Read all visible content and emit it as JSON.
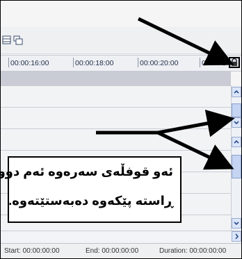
{
  "ruler": {
    "ticks": [
      "00:00:16:00",
      "00:00:18:00",
      "00:00:20:00",
      "00:00:2"
    ]
  },
  "status": {
    "start": "Start: 00:00:00:00",
    "end": "End: 00:00:00:00",
    "duration": "Duration: 00:00:00:00"
  },
  "caption": {
    "line1": "ئەو قوفڵەی سەرەوە ئەم دوو",
    "line2": "ڕاستە پێکەوە دەبەستێتەوە."
  },
  "icons": {
    "lock": "lock-icon",
    "scroll_up": "chevron-up-icon",
    "scroll_down": "chevron-down-icon",
    "scroll_right": "chevron-right-icon"
  },
  "colors": {
    "arrow": "#000000",
    "ruler_bg": "#eef0f4",
    "scroll_button": "#dbe6fa",
    "track_header": "#c9ccd4"
  }
}
